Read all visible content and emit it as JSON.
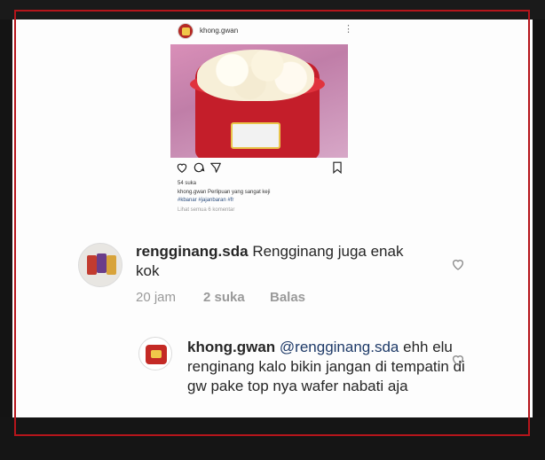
{
  "post": {
    "username": "khong.gwan",
    "more_icon": "⋮",
    "likes": "54 suka",
    "caption": "khong.gwan Perlipuan yang sangat keji",
    "hashtags": "#kbanar #jajanbaran #fr",
    "view_comments": "Lihat semua 6 komentar"
  },
  "comments": [
    {
      "username": "rengginang.sda",
      "text": "Rengginang juga enak kok",
      "time": "20 jam",
      "likes": "2 suka",
      "reply": "Balas"
    },
    {
      "username": "khong.gwan",
      "mention": "@rengginang.sda",
      "text": "ehh elu renginang kalo bikin jangan di tempatin di gw pake top nya wafer nabati aja"
    }
  ],
  "colors": {
    "frame": "#b5151b",
    "mention": "#1e3a68",
    "meta": "#9a9a9a"
  }
}
